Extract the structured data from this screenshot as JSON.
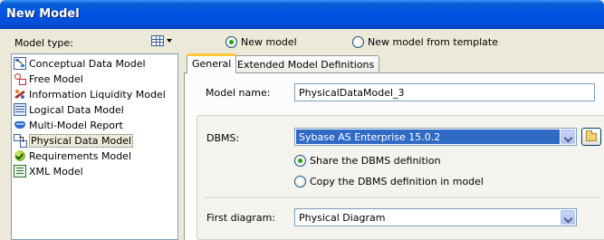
{
  "window": {
    "title": "New Model"
  },
  "left": {
    "model_type_label": "Model type:",
    "view_button_icon": "list-view-icon",
    "items": [
      {
        "label": "Conceptual Data Model",
        "icon": "conceptual-model-icon"
      },
      {
        "label": "Free Model",
        "icon": "free-model-icon"
      },
      {
        "label": "Information Liquidity Model",
        "icon": "information-liquidity-icon"
      },
      {
        "label": "Logical Data Model",
        "icon": "logical-model-icon"
      },
      {
        "label": "Multi-Model Report",
        "icon": "report-icon"
      },
      {
        "label": "Physical Data Model",
        "icon": "physical-model-icon",
        "selected": true
      },
      {
        "label": "Requirements Model",
        "icon": "requirements-icon"
      },
      {
        "label": "XML Model",
        "icon": "xml-model-icon"
      }
    ]
  },
  "options": {
    "new_model": {
      "label": "New model",
      "checked": true
    },
    "from_template": {
      "label": "New model from template",
      "checked": false
    }
  },
  "tabs": [
    {
      "label": "General",
      "active": true
    },
    {
      "label": "Extended Model Definitions",
      "active": false
    }
  ],
  "form": {
    "model_name_label": "Model name:",
    "model_name_value": "PhysicalDataModel_3",
    "dbms_label": "DBMS:",
    "dbms_value": "Sybase AS Enterprise 15.0.2",
    "share_label": "Share the DBMS definition",
    "share_checked": true,
    "copy_label": "Copy the DBMS definition in model",
    "copy_checked": false,
    "browse_icon": "folder-icon",
    "first_diagram_label": "First diagram:",
    "first_diagram_value": "Physical Diagram"
  }
}
